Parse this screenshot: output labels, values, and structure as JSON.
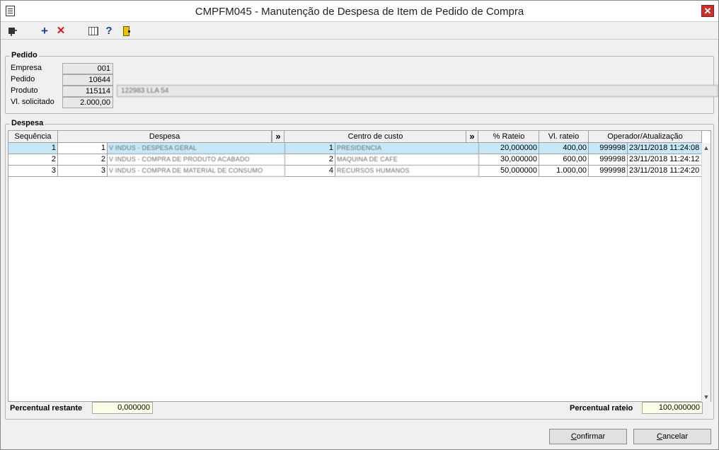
{
  "window": {
    "title": "CMPFM045 - Manutenção de Despesa de Item de Pedido de Compra",
    "close_glyph": "✕"
  },
  "toolbar": {
    "icons": [
      "first-record-icon",
      "add-icon",
      "delete-icon",
      "grid-icon",
      "help-icon",
      "exit-icon"
    ],
    "add_glyph": "+",
    "delete_glyph": "✕",
    "help_glyph": "?"
  },
  "pedido": {
    "group_label": "Pedido",
    "empresa_label": "Empresa",
    "empresa_value": "001",
    "pedido_label": "Pedido",
    "pedido_value": "10644",
    "produto_label": "Produto",
    "produto_value": "115114",
    "produto_desc": "122983 LLA 54",
    "vl_solicitado_label": "Vl. solicitado",
    "vl_solicitado_value": "2.000,00"
  },
  "despesa": {
    "group_label": "Despesa",
    "columns": {
      "sequencia": "Sequência",
      "despesa": "Despesa",
      "centro_custo": "Centro de custo",
      "rateio_pct": "% Rateio",
      "vl_rateio": "Vl. rateio",
      "operador": "Operador/Atualização",
      "more_glyph": "»"
    },
    "rows": [
      {
        "seq": "1",
        "desp_cod": "1",
        "desp_desc": "V INDUS - DESPESA GERAL",
        "cc_cod": "1",
        "cc_desc": "PRESIDENCIA",
        "rateio": "20,000000",
        "vl": "400,00",
        "op": "999998",
        "data": "23/11/2018 11:24:08"
      },
      {
        "seq": "2",
        "desp_cod": "2",
        "desp_desc": "V INDUS - COMPRA DE PRODUTO ACABADO",
        "cc_cod": "2",
        "cc_desc": "MAQUINA DE CAFE",
        "rateio": "30,000000",
        "vl": "600,00",
        "op": "999998",
        "data": "23/11/2018 11:24:12"
      },
      {
        "seq": "3",
        "desp_cod": "3",
        "desp_desc": "V INDUS - COMPRA DE MATERIAL DE CONSUMO",
        "cc_cod": "4",
        "cc_desc": "RECURSOS HUMANOS",
        "rateio": "50,000000",
        "vl": "1.000,00",
        "op": "999998",
        "data": "23/11/2018 11:24:20"
      }
    ],
    "selected_row": 1
  },
  "footer": {
    "restante_label": "Percentual restante",
    "restante_value": "0,000000",
    "rateio_label": "Percentual rateio",
    "rateio_value": "100,000000"
  },
  "buttons": {
    "confirmar_first": "C",
    "confirmar_rest": "onfirmar",
    "cancelar_first": "C",
    "cancelar_rest": "ancelar"
  },
  "colors": {
    "selected_row": "#c6e8f8",
    "footer_field_bg": "#ffffe8",
    "close_button": "#c9302c"
  }
}
